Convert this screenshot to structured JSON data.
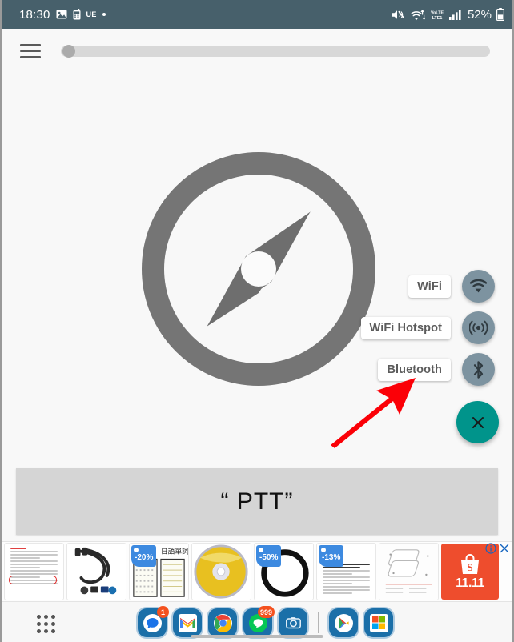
{
  "statusbar": {
    "time": "18:30",
    "left_icons": [
      "image-icon",
      "walkie-talkie-icon",
      "ue-label",
      "dot-indicator"
    ],
    "ue_label": "UE",
    "right_icons": [
      "mute-icon",
      "wifi-transfer-icon",
      "volte-icon",
      "signal-bars-icon"
    ],
    "volte_label_top": "VoLTE",
    "volte_label_bottom": "LTE1",
    "battery_percent": "52%",
    "background_color": "#47606b"
  },
  "topbar": {
    "menu_icon": "hamburger-menu-icon",
    "slider_value_label": ""
  },
  "main": {
    "compass_icon": "compass-icon",
    "fab_menu": {
      "items": [
        {
          "label": "WiFi",
          "icon": "wifi-icon"
        },
        {
          "label": "WiFi Hotspot",
          "icon": "hotspot-icon"
        },
        {
          "label": "Bluetooth",
          "icon": "bluetooth-icon"
        }
      ],
      "close_label": "×",
      "close_icon": "close-icon",
      "fab_color": "#00948b",
      "mini_fab_color": "#7d93a0"
    },
    "annotation": {
      "arrow_icon": "red-arrow-icon",
      "arrow_color": "#fb0007",
      "points_to": "Bluetooth"
    },
    "banner": {
      "text": "“ PTT”",
      "background_color": "#d5d5d5"
    }
  },
  "ads": {
    "cards": [
      {
        "name": "text-document-ad",
        "badge": ""
      },
      {
        "name": "cable-product-ad",
        "badge": ""
      },
      {
        "name": "notebook-ad",
        "badge": "-20%",
        "heading": "日造單詞速寫本"
      },
      {
        "name": "cd-disc-ad",
        "badge": ""
      },
      {
        "name": "ring-cable-ad",
        "badge": "-50%"
      },
      {
        "name": "korean-text-ad",
        "badge": "-13%"
      },
      {
        "name": "phone-case-ad",
        "badge": ""
      }
    ],
    "promo": {
      "brand": "Shopee",
      "logo_icon": "shopee-bag-icon",
      "campaign": "11.11",
      "color": "#ee4d2d"
    },
    "info_icon": "ad-info-icon",
    "close_icon": "ad-close-icon"
  },
  "dock": {
    "app_drawer_icon": "app-drawer-grid-icon",
    "apps": [
      {
        "name": "messages",
        "icon": "messages-icon",
        "badge": "1"
      },
      {
        "name": "gmail",
        "icon": "gmail-icon",
        "badge": ""
      },
      {
        "name": "chrome",
        "icon": "chrome-icon",
        "badge": ""
      },
      {
        "name": "line",
        "icon": "line-icon",
        "badge": "999"
      },
      {
        "name": "camera",
        "icon": "camera-icon",
        "badge": ""
      },
      {
        "name": "play-store",
        "icon": "play-store-icon",
        "badge": ""
      },
      {
        "name": "office",
        "icon": "office-icon",
        "badge": ""
      }
    ],
    "home_indicator": "home-indicator"
  }
}
